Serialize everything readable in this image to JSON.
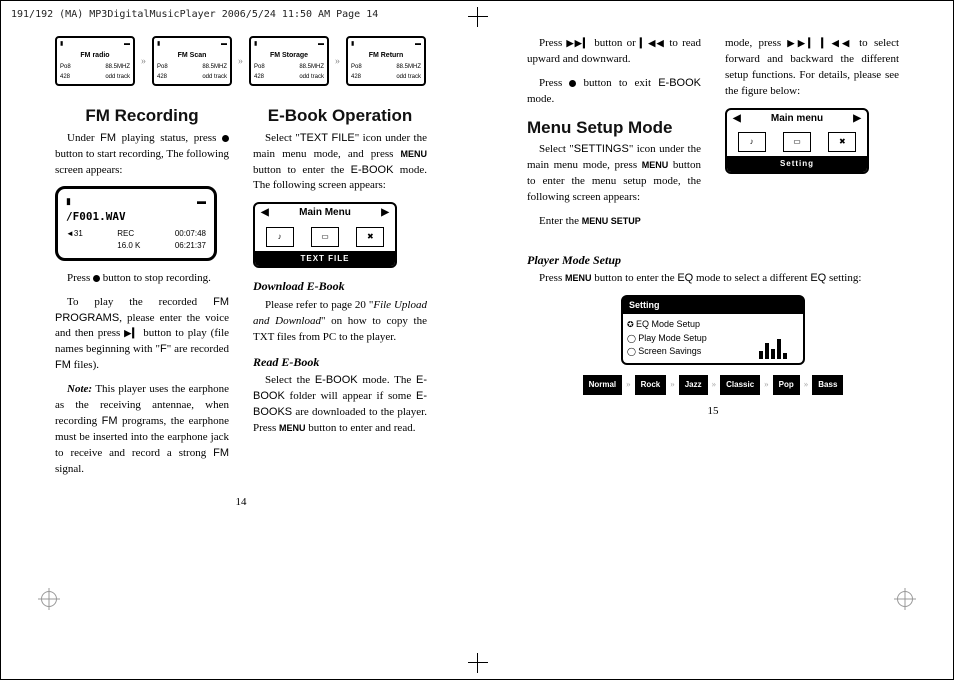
{
  "header": "191/192 (MA) MP3DigitalMusicPlayer  2006/5/24  11:50 AM  Page 14",
  "left": {
    "screens": [
      {
        "title": "FM radio",
        "l1": "Po8",
        "r1": "88.5MHZ",
        "l2": "428",
        "r2": "odd track"
      },
      {
        "title": "FM Scan",
        "l1": "Po8",
        "r1": "88.5MHZ",
        "l2": "428",
        "r2": "odd track"
      },
      {
        "title": "FM Storage",
        "l1": "Po8",
        "r1": "88.5MHZ",
        "l2": "428",
        "r2": "odd track"
      },
      {
        "title": "FM Return",
        "l1": "Po8",
        "r1": "88.5MHZ",
        "l2": "428",
        "r2": "odd track"
      }
    ],
    "fm_heading": "FM Recording",
    "fm_p1_a": "Under ",
    "fm_p1_b": "FM",
    "fm_p1_c": " playing status, press ",
    "fm_p1_d": " button to start recording, The following screen appears:",
    "player": {
      "file": "/F001.WAV",
      "rec": "REC",
      "bitrate": "16.0 K",
      "t1": "00:07:48",
      "t2": "06:21:37",
      "vol": "◄31"
    },
    "fm_p2_a": "Press ",
    "fm_p2_b": " button to stop recording.",
    "fm_p3_a": "To play the recorded ",
    "fm_p3_b": "FM PROGRAMS",
    "fm_p3_c": ", please enter the voice and then press ",
    "fm_p3_d": "▶▎",
    "fm_p3_e": " button to play (file names beginning with \"",
    "fm_p3_f": "F",
    "fm_p3_g": "\" are recorded ",
    "fm_p3_h": "FM",
    "fm_p3_i": " files).",
    "fm_note_a": "Note:",
    "fm_note_b": " This player uses the earphone as the receiving antennae, when recording ",
    "fm_note_c": "FM",
    "fm_note_d": " programs, the earphone must be inserted into the earphone jack to receive and record a strong ",
    "fm_note_e": "FM",
    "fm_note_f": " signal.",
    "eb_heading": "E-Book Operation",
    "eb_p1_a": "Select \"",
    "eb_p1_b": "TEXT FILE",
    "eb_p1_c": "\" icon under the main menu mode, and press ",
    "eb_p1_d": "MENU",
    "eb_p1_e": " button to enter the ",
    "eb_p1_f": "E-BOOK",
    "eb_p1_g": " mode. The following screen appears:",
    "mainmenu_title": "Main Menu",
    "mainmenu_foot": "TEXT FILE",
    "dl_heading": "Download E-Book",
    "dl_p_a": "Please refer to page 20 \"",
    "dl_p_b": "File Upload and Download",
    "dl_p_c": "\" on how to copy the TXT files from PC to the player.",
    "rd_heading": "Read E-Book",
    "rd_p_a": "Select the ",
    "rd_p_b": "E-BOOK",
    "rd_p_c": " mode. The ",
    "rd_p_d": "E-BOOK",
    "rd_p_e": " folder will appear if some ",
    "rd_p_f": "E-BOOKS",
    "rd_p_g": " are downloaded to the player. Press ",
    "rd_p_h": "MENU",
    "rd_p_i": " button to enter and read.",
    "pagenum": "14"
  },
  "right": {
    "r1_a": "Press ",
    "r1_b": "▶▶▎",
    "r1_c": " button or ",
    "r1_d": "▎◀◀",
    "r1_e": " to read upward and downward.",
    "r2_a": "Press ",
    "r2_b": " button to exit ",
    "r2_c": "E-BOOK",
    "r2_d": " mode.",
    "ms_heading": "Menu Setup Mode",
    "ms_p1_a": "Select \"",
    "ms_p1_b": "SETTINGS",
    "ms_p1_c": "\" icon under the main menu mode, press ",
    "ms_p1_d": "MENU",
    "ms_p1_e": " button to enter the menu setup mode, the following screen appears:",
    "ms_p2_a": "Enter the ",
    "ms_p2_b": "MENU SETUP",
    "rt2_a": "mode, press ",
    "rt2_b": "▶▶▎ ▎◀◀",
    "rt2_c": " to select forward and backward the different setup functions. For details, please see the figure below:",
    "mm2_title": "Main menu",
    "mm2_foot": "Setting",
    "pm_heading": "Player Mode Setup",
    "pm_p_a": "Press ",
    "pm_p_b": "MENU",
    "pm_p_c": " button to enter the ",
    "pm_p_d": "EQ",
    "pm_p_e": " mode to select a different ",
    "pm_p_f": "EQ",
    "pm_p_g": " setting:",
    "settings": {
      "head": "Setting",
      "opts": [
        "EQ Mode Setup",
        "Play Mode Setup",
        "Screen Savings"
      ]
    },
    "eq": [
      "Normal",
      "Rock",
      "Jazz",
      "Classic",
      "Pop",
      "Bass"
    ],
    "pagenum": "15"
  }
}
